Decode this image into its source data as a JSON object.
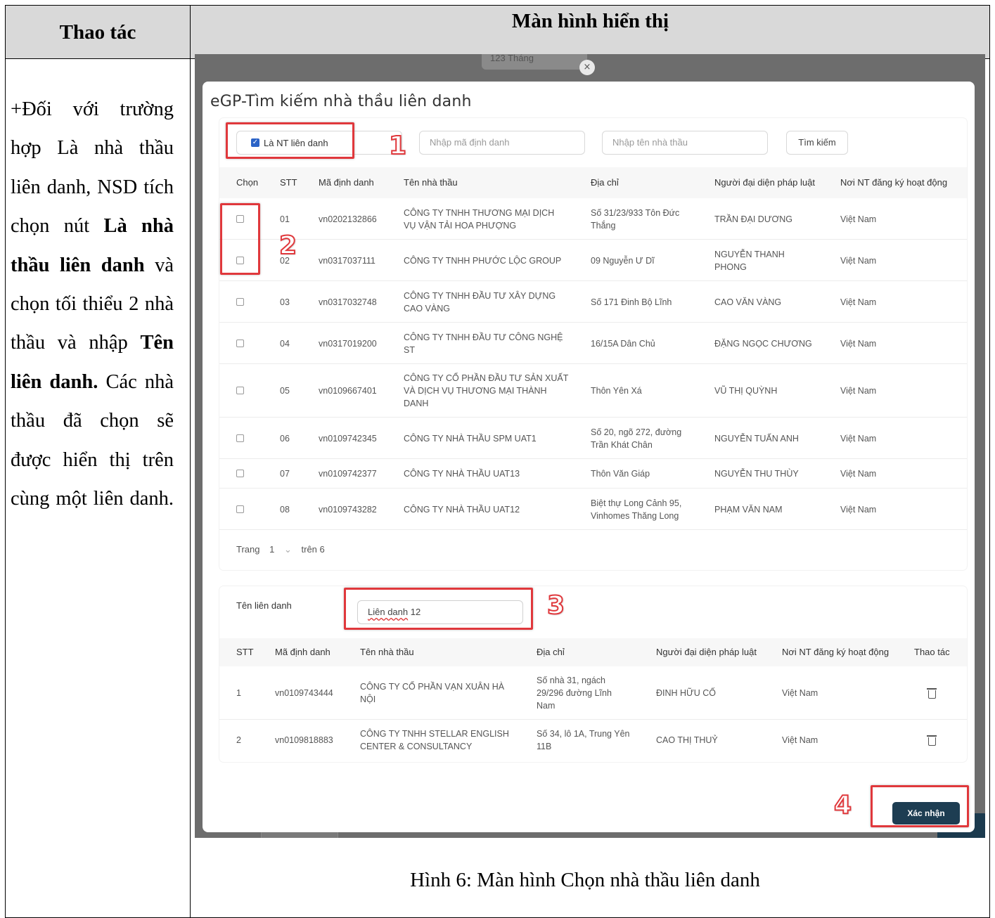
{
  "table_header": {
    "left": "Thao tác",
    "right": "Màn hình hiển thị"
  },
  "instructions": {
    "p1": "+Đối với trường hợp Là nhà thầu liên danh, NSD tích chọn nút ",
    "b1": "Là nhà thầu liên danh",
    "p2": " và chọn tối thiểu 2 nhà thầu và nhập ",
    "b2": "Tên liên danh.",
    "p3": " Các nhà thầu đã chọn sẽ được hiển thị trên cùng một liên danh."
  },
  "background": {
    "input_text": "123 Tháng",
    "close_icon": "×"
  },
  "modal": {
    "title": "eGP-Tìm kiếm nhà thầu liên danh",
    "checkbox_label": "Là NT liên danh",
    "code_placeholder": "Nhập mã định danh",
    "name_placeholder": "Nhập tên nhà thầu",
    "search_button": "Tìm kiếm",
    "columns": [
      "Chọn",
      "STT",
      "Mã định danh",
      "Tên nhà thầu",
      "Địa chỉ",
      "Người đại diện pháp luật",
      "Nơi NT đăng ký hoạt động"
    ],
    "rows": [
      {
        "stt": "01",
        "code": "vn0202132866",
        "name1": "CÔNG TY TNHH THƯƠNG MẠI DỊCH",
        "name2": "VỤ VẬN TẢI HOA PHƯỢNG",
        "name3": "",
        "addr1": "Số 31/23/933 Tôn Đức",
        "addr2": "Thắng",
        "rep1": "TRẦN ĐẠI DƯƠNG",
        "rep2": "",
        "place": "Việt Nam"
      },
      {
        "stt": "02",
        "code": "vn0317037111",
        "name1": "CÔNG TY TNHH PHƯỚC LỘC GROUP",
        "name2": "",
        "name3": "",
        "addr1": "09 Nguyễn Ư Dĩ",
        "addr2": "",
        "rep1": "NGUYỄN THANH",
        "rep2": "PHONG",
        "place": "Việt Nam"
      },
      {
        "stt": "03",
        "code": "vn0317032748",
        "name1": "CÔNG TY TNHH ĐẦU TƯ XÂY DỰNG",
        "name2": "CAO VÀNG",
        "name3": "",
        "addr1": "Số 171 Đinh Bộ Lĩnh",
        "addr2": "",
        "rep1": "CAO VĂN VÀNG",
        "rep2": "",
        "place": "Việt Nam"
      },
      {
        "stt": "04",
        "code": "vn0317019200",
        "name1": "CÔNG TY TNHH ĐẦU TƯ CÔNG NGHỆ",
        "name2": "ST",
        "name3": "",
        "addr1": "16/15A Dân Chủ",
        "addr2": "",
        "rep1": "ĐẶNG NGỌC CHƯƠNG",
        "rep2": "",
        "place": "Việt Nam"
      },
      {
        "stt": "05",
        "code": "vn0109667401",
        "name1": "CÔNG TY CỔ PHẦN ĐẦU TƯ SẢN XUẤT",
        "name2": "VÀ DỊCH VỤ THƯƠNG MẠI THÀNH",
        "name3": "DANH",
        "addr1": "Thôn Yên Xá",
        "addr2": "",
        "rep1": "VŨ THỊ QUỲNH",
        "rep2": "",
        "place": "Việt Nam"
      },
      {
        "stt": "06",
        "code": "vn0109742345",
        "name1": "CÔNG TY NHÀ THẦU SPM UAT1",
        "name2": "",
        "name3": "",
        "addr1": "Số 20, ngõ 272, đường",
        "addr2": "Trần Khát Chân",
        "rep1": "NGUYỄN TUẤN ANH",
        "rep2": "",
        "place": "Việt Nam"
      },
      {
        "stt": "07",
        "code": "vn0109742377",
        "name1": "CÔNG TY NHÀ THẦU UAT13",
        "name2": "",
        "name3": "",
        "addr1": "Thôn Văn Giáp",
        "addr2": "",
        "rep1": "NGUYỄN THU THÙY",
        "rep2": "",
        "place": "Việt Nam"
      },
      {
        "stt": "08",
        "code": "vn0109743282",
        "name1": "CÔNG TY NHÀ THẦU UAT12",
        "name2": "",
        "name3": "",
        "addr1": "Biệt thự Long Cảnh 95,",
        "addr2": "Vinhomes Thăng Long",
        "rep1": "PHẠM VĂN NAM",
        "rep2": "",
        "place": "Việt Nam"
      }
    ],
    "pager": {
      "label": "Trang",
      "page": "1",
      "chevron": "⌄",
      "total": "trên 6"
    },
    "joint_label": "Tên liên danh",
    "joint_value_a": "Liên danh",
    "joint_value_b": " 12",
    "columns2": [
      "STT",
      "Mã định danh",
      "Tên nhà thầu",
      "Địa chỉ",
      "Người đại diện pháp luật",
      "Nơi NT đăng ký hoạt động",
      "Thao tác"
    ],
    "rows2": [
      {
        "stt": "1",
        "code": "vn0109743444",
        "name1": "CÔNG TY CỔ PHẦN VẠN XUÂN HÀ",
        "name2": "NỘI",
        "addr1": "Số nhà 31, ngách",
        "addr2": "29/296 đường Lĩnh",
        "addr3": "Nam",
        "rep": "ĐINH HỮU CỐ",
        "place": "Việt Nam"
      },
      {
        "stt": "2",
        "code": "vn0109818883",
        "name1": "CÔNG TY TNHH STELLAR ENGLISH",
        "name2": "CENTER & CONSULTANCY",
        "addr1": "Số 34, lô 1A, Trung Yên",
        "addr2": "11B",
        "addr3": "",
        "rep": "CAO THỊ THUỶ",
        "place": "Việt Nam"
      }
    ],
    "confirm_button": "Xác nhận"
  },
  "annotations": [
    "1",
    "2",
    "3",
    "4"
  ],
  "caption": "Hình 6: Màn hình Chọn nhà thầu liên danh"
}
